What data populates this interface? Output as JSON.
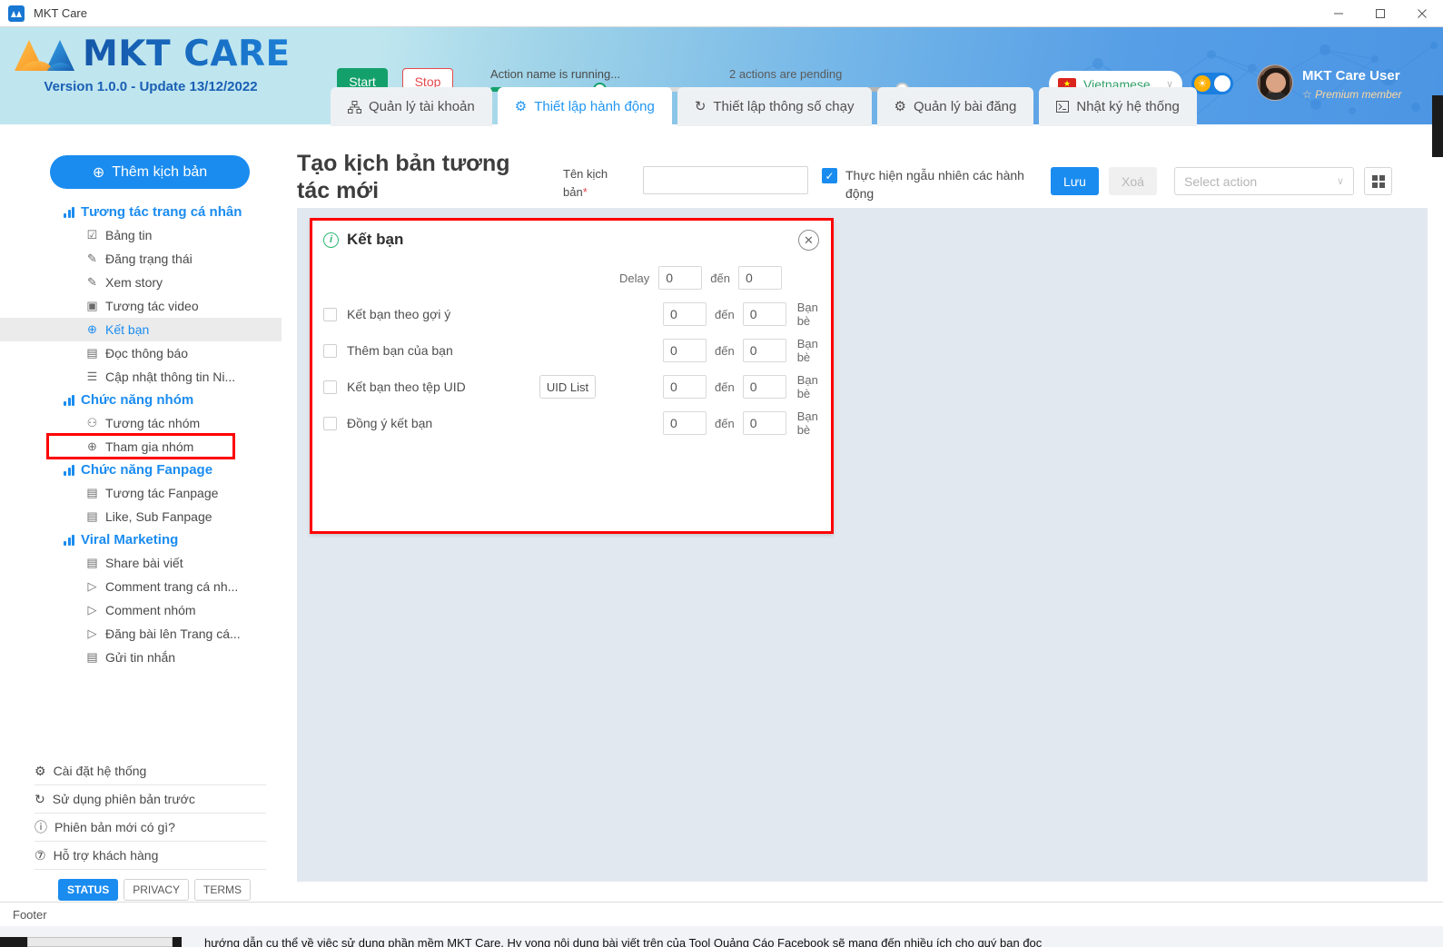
{
  "window": {
    "title": "MKT Care",
    "app_icon": "app-icon",
    "minimize": "—",
    "maximize": "□",
    "close": "✕"
  },
  "header": {
    "logo_text": "MKT CARE",
    "version": "Version 1.0.0 - Update 13/12/2022",
    "start_label": "Start",
    "stop_label": "Stop",
    "progress_running_label": "Action name is running...",
    "progress_pending_label": "2 actions are pending",
    "language": "Vietnamese",
    "language_caret": "∨",
    "theme_toggle_icon": "sun-icon",
    "user_name": "MKT Care User",
    "user_star": "☆",
    "user_membership": "Premium member"
  },
  "tabs": [
    {
      "label": "Quản lý tài khoản",
      "icon": "sitemap-icon",
      "glyph": "⇶",
      "active": false
    },
    {
      "label": "Thiết lập hành động",
      "icon": "gear-icon",
      "glyph": "⚙",
      "active": true
    },
    {
      "label": "Thiết lập thông số chạy",
      "icon": "refresh-icon",
      "glyph": "↻",
      "active": false
    },
    {
      "label": "Quản lý bài đăng",
      "icon": "gear-icon",
      "glyph": "⚙",
      "active": false
    },
    {
      "label": "Nhật ký hệ thống",
      "icon": "terminal-icon",
      "glyph": "▣",
      "active": false
    }
  ],
  "sidebar": {
    "add_button": "Thêm kịch bản",
    "add_icon": "plus-circle-icon",
    "groups": [
      {
        "label": "Tương tác trang cá nhân",
        "icon": "bar-chart-icon",
        "items": [
          {
            "label": "Bảng tin",
            "icon": "checkbox-icon",
            "glyph": "☑",
            "selected": false
          },
          {
            "label": "Đăng trạng thái",
            "icon": "edit-icon",
            "glyph": "✎",
            "selected": false
          },
          {
            "label": "Xem story",
            "icon": "edit-icon",
            "glyph": "✎",
            "selected": false
          },
          {
            "label": "Tương tác video",
            "icon": "play-icon",
            "glyph": "▶",
            "selected": false
          },
          {
            "label": "Kết bạn",
            "icon": "plus-circle-icon",
            "glyph": "⊕",
            "selected": true
          },
          {
            "label": "Đọc thông báo",
            "icon": "notification-icon",
            "glyph": "☷",
            "selected": false
          },
          {
            "label": "Cập nhật thông tin Ni...",
            "icon": "list-icon",
            "glyph": "☰",
            "selected": false
          }
        ]
      },
      {
        "label": "Chức năng nhóm",
        "icon": "bar-chart-icon",
        "items": [
          {
            "label": "Tương tác nhóm",
            "icon": "users-icon",
            "glyph": "♟",
            "selected": false
          },
          {
            "label": "Tham gia nhóm",
            "icon": "plus-circle-icon",
            "glyph": "⊕",
            "selected": false
          }
        ]
      },
      {
        "label": "Chức năng Fanpage",
        "icon": "bar-chart-icon",
        "items": [
          {
            "label": "Tương tác Fanpage",
            "icon": "page-icon",
            "glyph": "☷",
            "selected": false
          },
          {
            "label": "Like, Sub Fanpage",
            "icon": "page-icon",
            "glyph": "☷",
            "selected": false
          }
        ]
      },
      {
        "label": "Viral Marketing",
        "icon": "bar-chart-icon",
        "items": [
          {
            "label": "Share bài viết",
            "icon": "page-icon",
            "glyph": "☷",
            "selected": false
          },
          {
            "label": "Comment trang cá nh...",
            "icon": "play-circle-icon",
            "glyph": "▷",
            "selected": false
          },
          {
            "label": "Comment nhóm",
            "icon": "play-circle-icon",
            "glyph": "▷",
            "selected": false
          },
          {
            "label": "Đăng bài lên Trang cá...",
            "icon": "play-circle-icon",
            "glyph": "▷",
            "selected": false
          },
          {
            "label": "Gửi tin nhắn",
            "icon": "page-icon",
            "glyph": "☷",
            "selected": false
          }
        ]
      }
    ],
    "footer_links": [
      {
        "label": "Cài đặt hệ thống",
        "icon": "gear-icon",
        "glyph": "⚙"
      },
      {
        "label": "Sử dụng phiên bản trước",
        "icon": "refresh-icon",
        "glyph": "↻"
      },
      {
        "label": "Phiên bản mới có gì?",
        "icon": "info-icon",
        "glyph": "ⓘ"
      },
      {
        "label": "Hỗ trợ khách hàng",
        "icon": "help-icon",
        "glyph": "?"
      }
    ],
    "chips": [
      {
        "label": "STATUS",
        "active": true
      },
      {
        "label": "PRIVACY",
        "active": false
      },
      {
        "label": "TERMS",
        "active": false
      }
    ]
  },
  "main": {
    "title": "Tạo kịch bản tương tác mới",
    "field_label": "Tên kịch bản",
    "field_required_mark": "*",
    "name_value": "",
    "name_placeholder": "",
    "random_checkbox_label": "Thực hiện ngẫu nhiên các hành động",
    "random_checked": true,
    "check_glyph": "✓",
    "save_label": "Lưu",
    "delete_label": "Xoá",
    "select_action_placeholder": "Select action",
    "select_caret": "∨",
    "grid_icon": "grid-icon"
  },
  "panel": {
    "title": "Kết bạn",
    "info_icon": "info-icon",
    "info_glyph": "i",
    "close_glyph": "✕",
    "delay_label": "Delay",
    "den_label": "đến",
    "unit_label": "Bạn bè",
    "delay_from": "0",
    "delay_to": "0",
    "rows": [
      {
        "label": "Kết bạn theo gợi ý",
        "checked": false,
        "from": "0",
        "to": "0",
        "unit": "Bạn bè",
        "button": null
      },
      {
        "label": "Thêm bạn của bạn",
        "checked": false,
        "from": "0",
        "to": "0",
        "unit": "Bạn bè",
        "button": null
      },
      {
        "label": "Kết bạn theo tệp UID",
        "checked": false,
        "from": "0",
        "to": "0",
        "unit": "Bạn bè",
        "button": "UID List"
      },
      {
        "label": "Đồng ý kết bạn",
        "checked": false,
        "from": "0",
        "to": "0",
        "unit": "Bạn bè",
        "button": null
      }
    ]
  },
  "footer": {
    "label": "Footer",
    "background_text": "hướng dẫn cụ thể về việc sử dụng phần mềm MKT Care. Hy vọng nội dung bài viết trên của Tool Quảng Cáo Facebook sẽ mang đến nhiều ích cho quý bạn đọc"
  },
  "colors": {
    "accent_blue": "#1a8cf0",
    "start_green": "#14a06b",
    "stop_red": "#e5484d",
    "highlight_red": "#ff0000",
    "canvas_bg": "#e2e8ef",
    "info_green": "#2eb872"
  }
}
